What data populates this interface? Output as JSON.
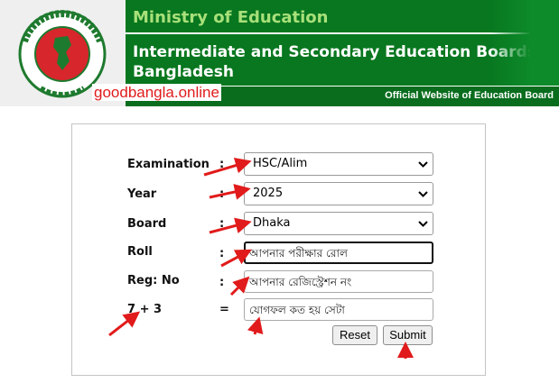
{
  "header": {
    "ministry": "Ministry of Education",
    "boards_title": "Intermediate and Secondary Education Boards Bangladesh",
    "watermark": "goodbangla.online",
    "official": "Official Website of Education Board",
    "seal_text_top": "গণপ্রজাতন্ত্রী বাংলাদেশ",
    "seal_text_bottom": "সরকার"
  },
  "form": {
    "fields": [
      {
        "label": "Examination",
        "sep": ":",
        "value": "HSC/Alim"
      },
      {
        "label": "Year",
        "sep": ":",
        "value": "2025"
      },
      {
        "label": "Board",
        "sep": ":",
        "value": "Dhaka"
      },
      {
        "label": "Roll",
        "sep": ":",
        "placeholder": "আপনার পরীক্ষার রোল"
      },
      {
        "label": "Reg: No",
        "sep": ":",
        "placeholder": "আপনার রেজিস্ট্রেশন নং"
      },
      {
        "label": "7 + 3",
        "sep": "=",
        "placeholder": "যোগফল কত হয় সেটা"
      }
    ],
    "reset_label": "Reset",
    "submit_label": "Submit"
  },
  "colors": {
    "header_green": "#08771f",
    "ministry_text": "#a8e07a",
    "arrow_red": "#e11b1b"
  },
  "icons": [
    "chevron-down-icon",
    "red-arrow-icon",
    "govt-seal-icon"
  ]
}
